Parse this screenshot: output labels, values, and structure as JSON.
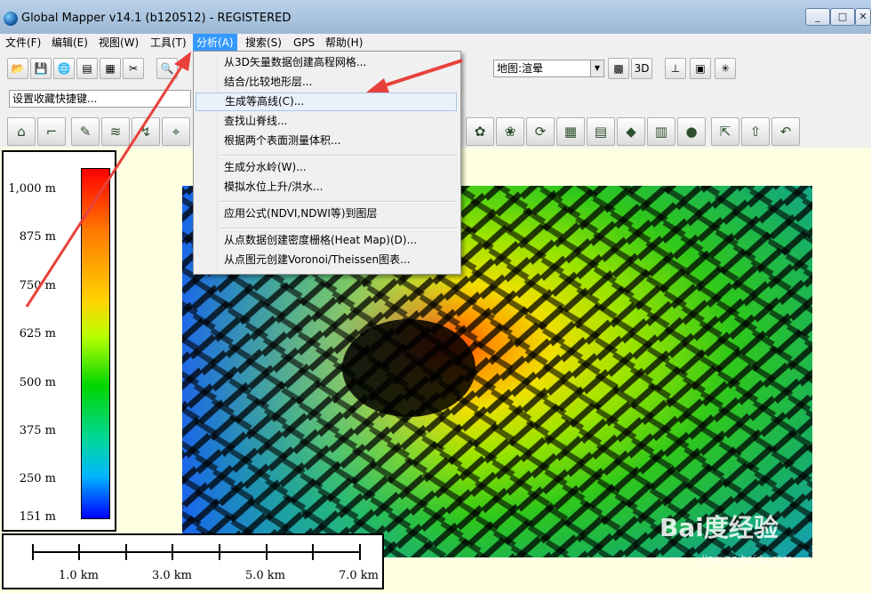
{
  "window": {
    "title": "Global Mapper v14.1 (b120512) - REGISTERED",
    "min": "_",
    "max": "□",
    "close": "✕"
  },
  "menu": [
    "文件(F)",
    "编辑(E)",
    "视图(W)",
    "工具(T)",
    "分析(A)",
    "搜索(S)",
    "GPS",
    "帮助(H)"
  ],
  "menu_active": "分析(A)",
  "toolbar": {
    "shortcut_placeholder": "设置收藏快捷键...",
    "render_select": "地图:渲晕"
  },
  "dropdown": {
    "items": [
      "从3D矢量数据创建高程网格...",
      "结合/比较地形层...",
      "生成等高线(C)...",
      "查找山脊线...",
      "根据两个表面测量体积...",
      "生成分水岭(W)...",
      "模拟水位上升/洪水...",
      "应用公式(NDVI,NDWI等)到图层",
      "从点数据创建密度栅格(Heat Map)(D)...",
      "从点图元创建Voronoi/Theissen图表..."
    ],
    "highlighted": "生成等高线(C)..."
  },
  "legend": {
    "labels": [
      "1,000 m",
      "875 m",
      "750 m",
      "625 m",
      "500 m",
      "375 m",
      "250 m",
      "151 m"
    ]
  },
  "scale_bar": {
    "labels": [
      "1.0 km",
      "3.0 km",
      "5.0 km",
      "7.0 km"
    ]
  },
  "watermark": {
    "main": "Bai度经验",
    "sub": "jingyan.baidu.com"
  },
  "colors": {
    "menu_active": "#3399ff",
    "annotation_arrow": "#e8413b",
    "map_background": "#ffffe1"
  }
}
